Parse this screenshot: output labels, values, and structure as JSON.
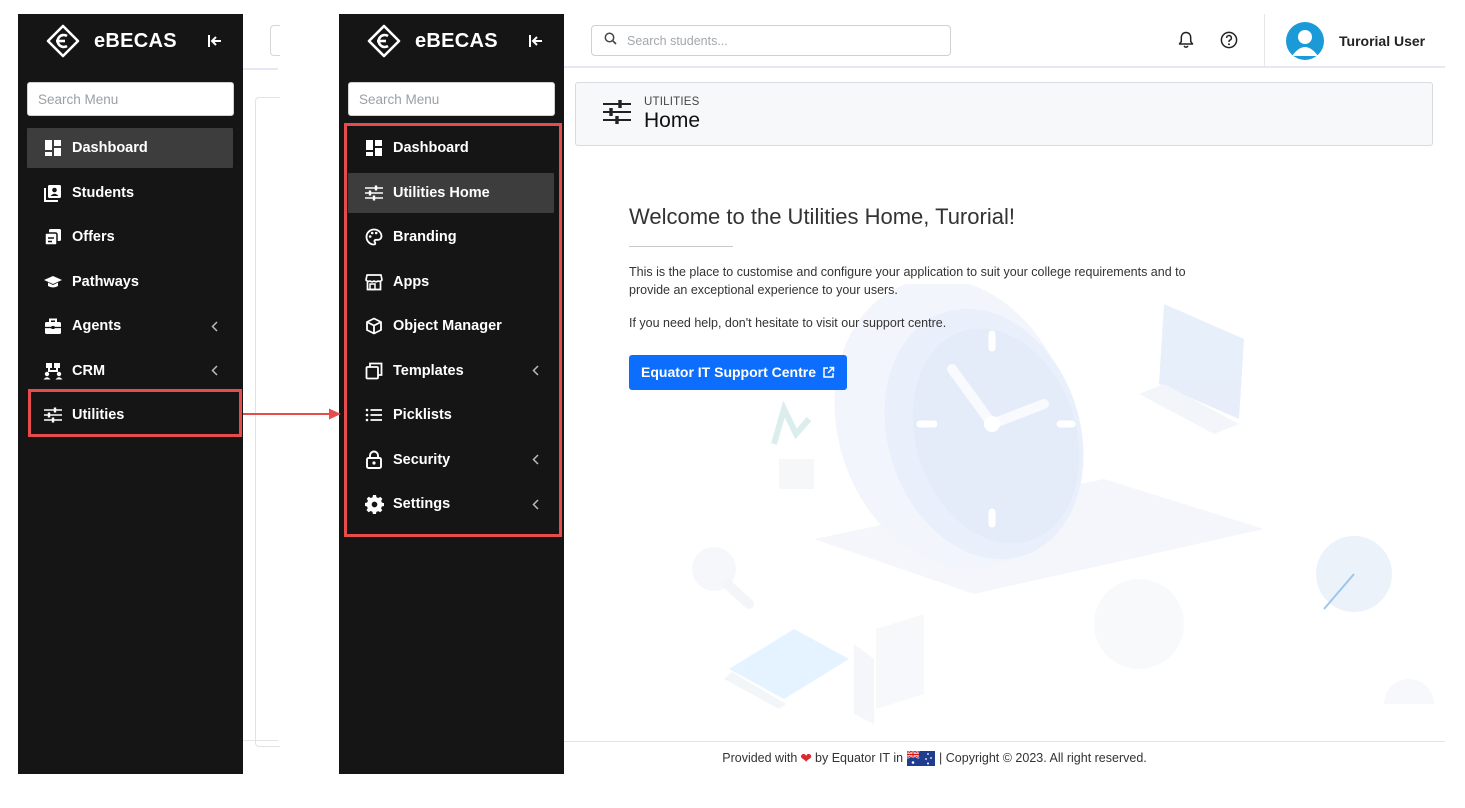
{
  "brand": {
    "name": "eBECAS"
  },
  "sidebar": {
    "search_placeholder": "Search Menu",
    "left_items": [
      {
        "label": "Dashboard",
        "icon": "dashboard-icon",
        "active": true
      },
      {
        "label": "Students",
        "icon": "students-icon"
      },
      {
        "label": "Offers",
        "icon": "offers-icon"
      },
      {
        "label": "Pathways",
        "icon": "graduation-cap-icon"
      },
      {
        "label": "Agents",
        "icon": "briefcase-icon",
        "chevron": true
      },
      {
        "label": "CRM",
        "icon": "crm-icon",
        "chevron": true
      },
      {
        "label": "Utilities",
        "icon": "sliders-icon"
      }
    ],
    "right_items": [
      {
        "label": "Dashboard",
        "icon": "dashboard-icon"
      },
      {
        "label": "Utilities Home",
        "icon": "sliders-icon",
        "active": true
      },
      {
        "label": "Branding",
        "icon": "palette-icon"
      },
      {
        "label": "Apps",
        "icon": "store-icon"
      },
      {
        "label": "Object Manager",
        "icon": "cube-icon"
      },
      {
        "label": "Templates",
        "icon": "templates-icon",
        "chevron": true
      },
      {
        "label": "Picklists",
        "icon": "list-icon"
      },
      {
        "label": "Security",
        "icon": "lock-icon",
        "chevron": true
      },
      {
        "label": "Settings",
        "icon": "gear-icon",
        "chevron": true
      }
    ]
  },
  "topbar": {
    "search_placeholder": "Search students...",
    "user_name": "Turorial User"
  },
  "page_header": {
    "section": "UTILITIES",
    "title": "Home"
  },
  "content": {
    "welcome": "Welcome to the Utilities Home, Turorial!",
    "para1": "This is the place to customise and configure your application to suit your college requirements and to provide an exceptional experience to your users.",
    "para2": "If you need help, don't hesitate to visit our support centre.",
    "support_button": "Equator IT Support Centre"
  },
  "footer": {
    "prefix": "Provided with",
    "by": "by Equator IT in",
    "copyright": "| Copyright © 2023. All right reserved."
  },
  "colors": {
    "sidebar_bg": "#151515",
    "active_item": "#3d3d3d",
    "primary": "#0d6efd",
    "highlight": "#e74c4c",
    "avatar": "#1a9bd7"
  }
}
